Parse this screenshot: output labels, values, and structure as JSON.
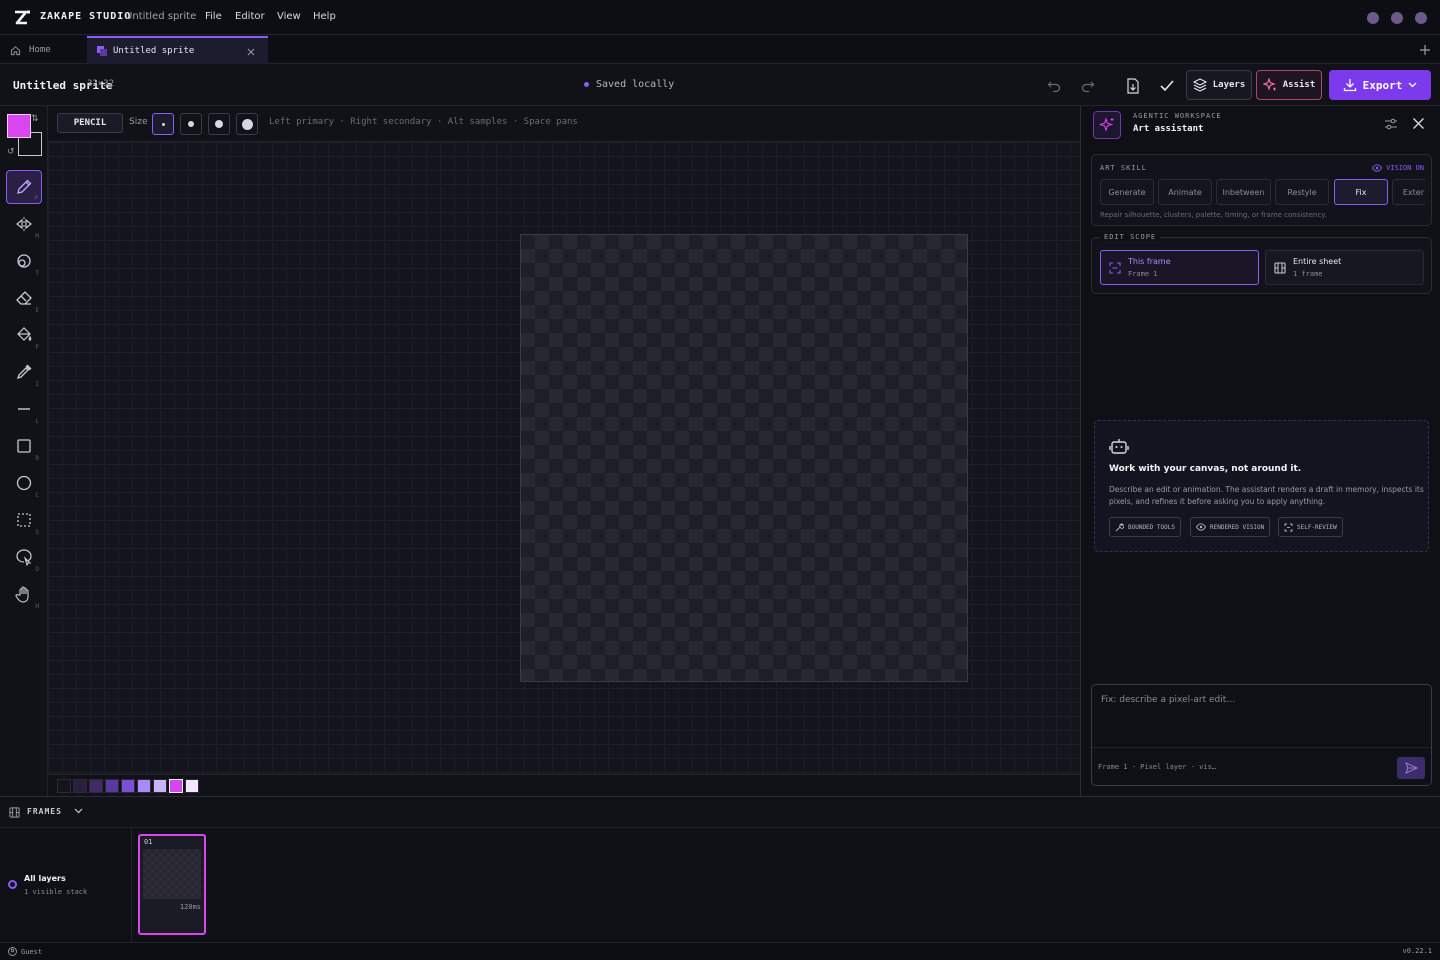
{
  "app": {
    "brand": "ZAKAPE STUDIO",
    "document_name": "Untitled sprite",
    "menus": [
      "File",
      "Editor",
      "View",
      "Help"
    ],
    "window_dot_color": "#6b5a8a"
  },
  "tabs": {
    "home": "Home",
    "sprite": "Untitled sprite"
  },
  "header": {
    "title": "Untitled sprite",
    "dimensions": "32×32",
    "save_status": "Saved locally",
    "layers_label": "Layers",
    "assist_label": "Assist",
    "export_label": "Export"
  },
  "toolbar": {
    "primary_color": "#d946ef",
    "tools": [
      {
        "name": "pencil",
        "key": "P",
        "active": true
      },
      {
        "name": "mirror",
        "key": "M"
      },
      {
        "name": "shape-blend",
        "key": "T"
      },
      {
        "name": "eraser",
        "key": "E"
      },
      {
        "name": "fill",
        "key": "F"
      },
      {
        "name": "eyedropper",
        "key": "I"
      },
      {
        "name": "line",
        "key": "L"
      },
      {
        "name": "rectangle",
        "key": "R"
      },
      {
        "name": "circle",
        "key": "C"
      },
      {
        "name": "selection",
        "key": "S"
      },
      {
        "name": "lasso",
        "key": "O"
      },
      {
        "name": "hand",
        "key": "H"
      }
    ]
  },
  "options": {
    "tool_name": "PENCIL",
    "size_label": "Size",
    "hint": "Left primary · Right secondary · Alt samples · Space pans"
  },
  "palette": [
    "#15141c",
    "#2a1f3d",
    "#3f2a66",
    "#5b3aa0",
    "#7c4fd6",
    "#a78bfa",
    "#c4b5fd",
    "#d946ef",
    "#f3e8ff"
  ],
  "panel": {
    "eyebrow": "AGENTIC WORKSPACE",
    "title": "Art assistant",
    "skill_label": "ART SKILL",
    "vision": "VISION ON",
    "skills": [
      "Generate",
      "Animate",
      "Inbetween",
      "Restyle",
      "Fix",
      "Exter"
    ],
    "selected_skill": "Fix",
    "skill_description": "Repair silhouette, clusters, palette, timing, or frame consistency.",
    "scope_label": "EDIT SCOPE",
    "scope_this_title": "This frame",
    "scope_this_sub": "Frame 1",
    "scope_sheet_title": "Entire sheet",
    "scope_sheet_sub": "1 frame",
    "empty_title": "Work with your canvas, not around it.",
    "empty_body": "Describe an edit or animation. The assistant renders a draft in memory, inspects its pixels, and refines it before asking you to apply anything.",
    "chips": [
      "BOUNDED TOOLS",
      "RENDERED VISION",
      "SELF-REVIEW"
    ],
    "prompt_placeholder": "Fix: describe a pixel-art edit…",
    "composer_context": "Frame 1 · Pixel layer · vis…"
  },
  "frames": {
    "label": "FRAMES",
    "layer_name": "All layers",
    "layer_sub": "1 visible stack",
    "frame_number": "01",
    "frame_duration": "120ms"
  },
  "status": {
    "user": "Guest",
    "version": "v0.22.1"
  }
}
